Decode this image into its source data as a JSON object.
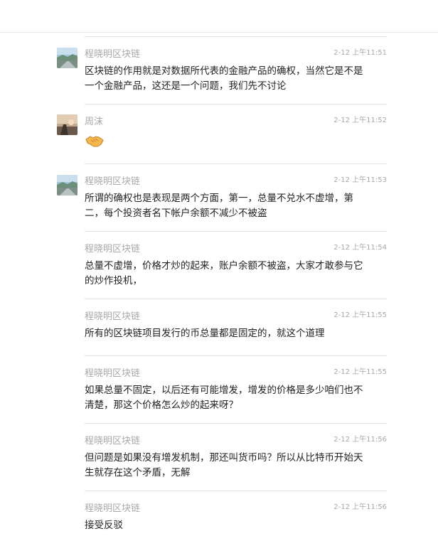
{
  "messages": [
    {
      "sender": "程晓明区块链",
      "time": "2-12 上午11:51",
      "text": "区块链的作用就是对数据所代表的金融产品的确权，当然它是不是一个金融产品，这还是一个问题，我们先不讨论",
      "avatar": "landscape"
    },
    {
      "sender": "周沫",
      "time": "2-12 上午11:52",
      "text": "",
      "emoji": "handshake-emoji",
      "avatar": "sunset"
    },
    {
      "sender": "程晓明区块链",
      "time": "2-12 上午11:53",
      "text": "所谓的确权也是表现是两个方面，第一，总量不兑水不虚增，第二，每个投资者名下帐户余额不减少不被盗",
      "avatar": "landscape"
    },
    {
      "sender": "程晓明区块链",
      "time": "2-12 上午11:54",
      "text": "总量不虚增，价格才炒的起来，账户余额不被盗，大家才敢参与它的炒作投机，"
    },
    {
      "sender": "程晓明区块链",
      "time": "2-12 上午11:55",
      "text": "所有的区块链项目发行的币总量都是固定的，就这个道理"
    },
    {
      "sender": "程晓明区块链",
      "time": "2-12 上午11:55",
      "text": "如果总量不固定，以后还有可能增发，增发的价格是多少咱们也不清楚，那这个价格怎么炒的起来呀？"
    },
    {
      "sender": "程晓明区块链",
      "time": "2-12 上午11:56",
      "text": "但问题是如果没有增发机制，那还叫货币吗？所以从比特币开始天生就存在这个矛盾，无解"
    },
    {
      "sender": "程晓明区块链",
      "time": "2-12 上午11:56",
      "text": "接受反驳"
    }
  ]
}
